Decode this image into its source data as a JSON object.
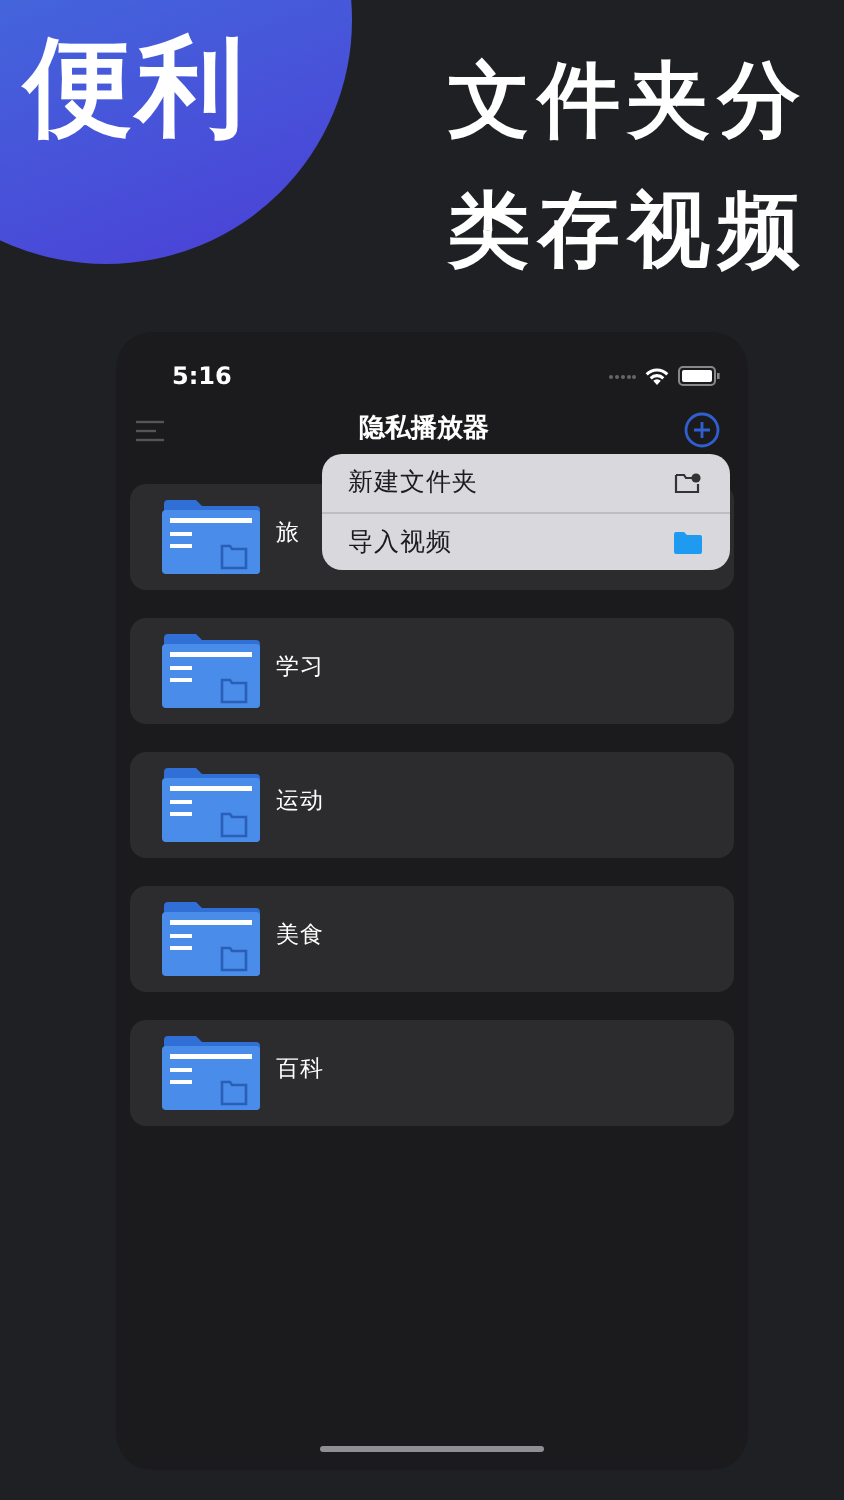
{
  "promo": {
    "badge": "便利",
    "headline": [
      "文件夹分",
      "类存视频"
    ]
  },
  "status_bar": {
    "time": "5:16"
  },
  "nav": {
    "title": "隐私播放器"
  },
  "folders": [
    {
      "name": "旅"
    },
    {
      "name": "学习"
    },
    {
      "name": "运动"
    },
    {
      "name": "美食"
    },
    {
      "name": "百科"
    }
  ],
  "menu": {
    "items": [
      {
        "label": "新建文件夹",
        "kind": "new-folder"
      },
      {
        "label": "导入视频",
        "kind": "import"
      }
    ]
  }
}
